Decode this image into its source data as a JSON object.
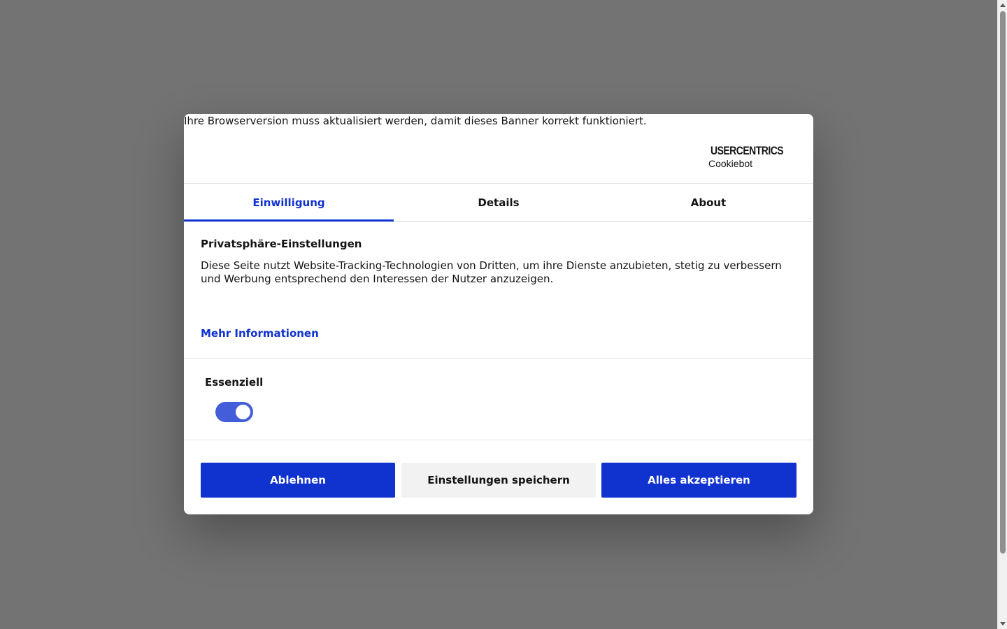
{
  "banner": {
    "browser_warning": "Ihre Browserversion muss aktualisiert werden, damit dieses Banner korrekt funktioniert.",
    "brand": {
      "name": "USERCENTRICS",
      "product": "Cookiebot",
      "icon": "shield-icon"
    },
    "tabs": [
      {
        "label": "Einwilligung",
        "active": true
      },
      {
        "label": "Details",
        "active": false
      },
      {
        "label": "About",
        "active": false
      }
    ],
    "content": {
      "title": "Privatsphäre-Einstellungen",
      "text": "Diese Seite nutzt Website-Tracking-Technologien von Dritten, um ihre Dienste anzubieten, stetig zu verbessern und Werbung entsprechend den Interessen der Nutzer anzuzeigen.",
      "more_info": "Mehr Informationen"
    },
    "category": {
      "label": "Essenziell",
      "enabled": true
    },
    "buttons": {
      "decline": "Ablehnen",
      "save": "Einstellungen speichern",
      "accept": "Alles akzeptieren"
    },
    "colors": {
      "accent": "#1032cf",
      "text": "#141414",
      "secondary_button": "#f2f2f2",
      "overlay": "#727272"
    }
  }
}
